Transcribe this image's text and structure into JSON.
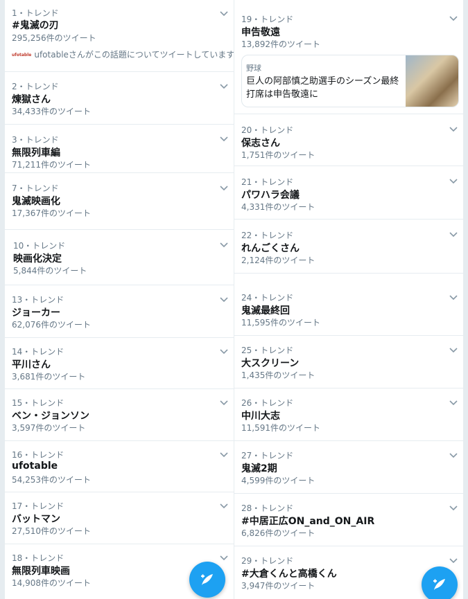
{
  "left_column": [
    {
      "meta": "1・トレンド",
      "name": "#鬼滅の刃",
      "count": "295,256件のツイート",
      "context": "ufotableさんがこの話題についてツイートしています",
      "context_logo": "ufotable"
    },
    {
      "meta": "2・トレンド",
      "name": "煉獄さん",
      "count": "34,433件のツイート"
    },
    {
      "meta": "3・トレンド",
      "name": "無限列車編",
      "count": "71,211件のツイート"
    },
    {
      "meta": "7・トレンド",
      "name": "鬼滅映画化",
      "count": "17,367件のツイート"
    },
    {
      "meta": "10・トレンド",
      "name": "映画化決定",
      "count": "5,844件のツイート"
    },
    {
      "meta": "13・トレンド",
      "name": "ジョーカー",
      "count": "62,076件のツイート"
    },
    {
      "meta": "14・トレンド",
      "name": "平川さん",
      "count": "3,681件のツイート"
    },
    {
      "meta": "15・トレンド",
      "name": "ベン・ジョンソン",
      "count": "3,597件のツイート"
    },
    {
      "meta": "16・トレンド",
      "name": "ufotable",
      "count": "54,253件のツイート"
    },
    {
      "meta": "17・トレンド",
      "name": "バットマン",
      "count": "27,510件のツイート"
    },
    {
      "meta": "18・トレンド",
      "name": "無限列車映画",
      "count": "14,908件のツイート"
    }
  ],
  "right_column": [
    {
      "meta": "19・トレンド",
      "name": "申告敬遠",
      "count": "13,892件のツイート",
      "card": {
        "label": "野球",
        "text": "巨人の阿部慎之助選手のシーズン最終打席は申告敬遠に"
      }
    },
    {
      "meta": "20・トレンド",
      "name": "保志さん",
      "count": "1,751件のツイート"
    },
    {
      "meta": "21・トレンド",
      "name": "パワハラ会議",
      "count": "4,331件のツイート"
    },
    {
      "meta": "22・トレンド",
      "name": "れんごくさん",
      "count": "2,124件のツイート"
    },
    {
      "meta": "24・トレンド",
      "name": "鬼滅最終回",
      "count": "11,595件のツイート"
    },
    {
      "meta": "25・トレンド",
      "name": "大スクリーン",
      "count": "1,435件のツイート"
    },
    {
      "meta": "26・トレンド",
      "name": "中川大志",
      "count": "11,591件のツイート"
    },
    {
      "meta": "27・トレンド",
      "name": "鬼滅2期",
      "count": "4,599件のツイート"
    },
    {
      "meta": "28・トレンド",
      "name": "#中居正広ON_and_ON_AIR",
      "count": "6,826件のツイート"
    },
    {
      "meta": "29・トレンド",
      "name": "#大倉くんと高橋くん",
      "count": "3,947件のツイート"
    }
  ],
  "icons": {
    "more": "chevron-down-icon",
    "compose": "compose-tweet-icon"
  },
  "colors": {
    "accent": "#1da1f2",
    "secondary_text": "#657786",
    "divider": "#e6ecf0"
  }
}
